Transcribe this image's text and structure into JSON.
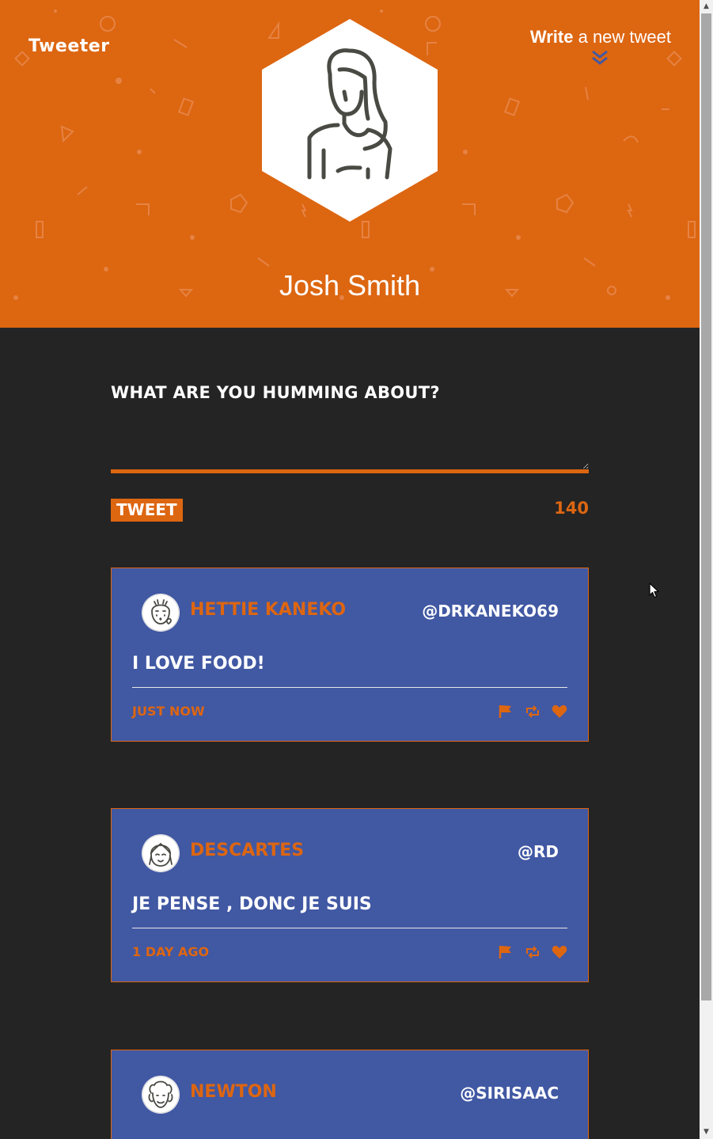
{
  "header": {
    "brand": "Tweeter",
    "write_bold": "Write",
    "write_rest": " a new tweet",
    "username": "Josh Smith"
  },
  "compose": {
    "label": "What are you humming about?",
    "input_value": "",
    "tweet_button": "Tweet",
    "counter": "140"
  },
  "tweets": [
    {
      "name": "Hettie Kaneko",
      "handle": "@drkaneko69",
      "text": "I love food!",
      "time": "just now"
    },
    {
      "name": "Descartes",
      "handle": "@rd",
      "text": "Je pense , donc je suis",
      "time": "1 day ago"
    },
    {
      "name": "Newton",
      "handle": "@SirIsaac",
      "text": "",
      "time": ""
    }
  ],
  "colors": {
    "accent": "#dd6611",
    "background": "#242424",
    "card": "#4158a3"
  },
  "icons": {
    "flag": "flag-icon",
    "retweet": "retweet-icon",
    "like": "heart-icon",
    "write_chevron": "double-chevron-down-icon"
  }
}
